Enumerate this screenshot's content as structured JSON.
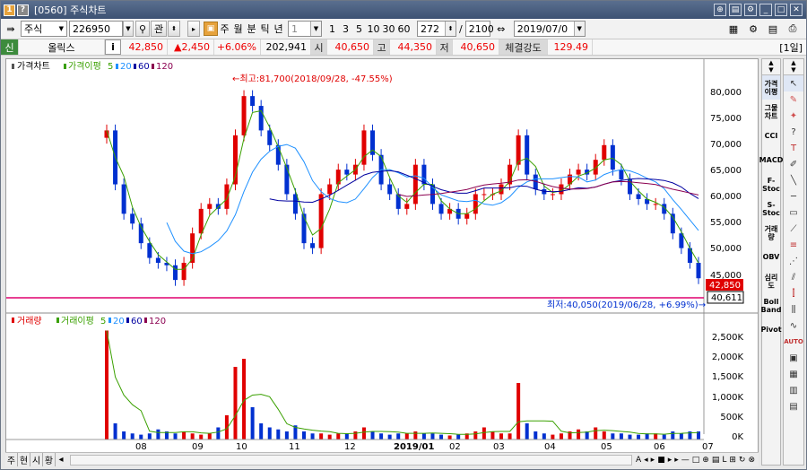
{
  "window": {
    "title": "[0560] 주식차트"
  },
  "toolbar": {
    "market_type": "주식",
    "code": "226950",
    "period_buttons": [
      "주",
      "월",
      "분",
      "틱",
      "년"
    ],
    "interval_value": "1",
    "interval_buttons": [
      "1",
      "3",
      "5",
      "10",
      "30",
      "60"
    ],
    "view_count": "272",
    "total_count": "2100",
    "date": "2019/07/0",
    "sep": "/",
    "search_label": "관"
  },
  "quote": {
    "tag": "신",
    "name": "올릭스",
    "info_btn": "i",
    "price": "42,850",
    "change": "▲2,450",
    "change_pct": "+6.06%",
    "volume": "202,941",
    "open_label": "시",
    "open": "40,650",
    "high_label": "고",
    "high": "44,350",
    "low_label": "저",
    "low": "40,650",
    "strength_label": "체결강도",
    "strength": "129.49",
    "period_tag": "[1일]"
  },
  "price_pane": {
    "legend_title": "가격차트",
    "legend_ma": "가격이평",
    "legend_ma_periods": [
      "5",
      "20",
      "60",
      "120"
    ],
    "y_ticks": [
      "80,000",
      "75,000",
      "70,000",
      "65,000",
      "60,000",
      "55,000",
      "50,000",
      "45,000"
    ],
    "high_annotation": "←최고:81,700(2018/09/28, -47.55%)",
    "low_annotation": "최저:40,050(2019/06/28, +6.99%)→",
    "current_price_label": "42,850",
    "cursor_price_label": "40,611"
  },
  "volume_pane": {
    "legend_title": "거래량",
    "legend_ma": "거래이평",
    "legend_ma_periods": [
      "5",
      "20",
      "60",
      "120"
    ],
    "y_ticks": [
      "2,500K",
      "2,000K",
      "1,500K",
      "1,000K",
      "500K",
      "0K"
    ]
  },
  "x_axis": {
    "labels": [
      "08",
      "09",
      "10",
      "11",
      "12",
      "2019/01",
      "02",
      "03",
      "04",
      "05",
      "06",
      "07"
    ]
  },
  "indicators": [
    "가격이평",
    "그물차트",
    "CCI",
    "MACD",
    "F-Stoc",
    "S-Stoc",
    "거래량",
    "OBV",
    "심리도",
    "Boll Band",
    "Pivot"
  ],
  "bottom_tabs": [
    "주",
    "현",
    "시",
    "황"
  ],
  "colors": {
    "up": "#e00000",
    "down": "#0030d0",
    "ma5": "#3aa000",
    "ma20": "#1e90ff",
    "ma60": "#0000a0",
    "ma120": "#8b0050",
    "low_line": "#e0006e"
  },
  "chart_data": {
    "type": "candlestick",
    "x_range": [
      "2018/07",
      "2019/07"
    ],
    "y_range": [
      40000,
      83000
    ],
    "annotations": {
      "high": 81700,
      "high_date": "2018/09/28",
      "low": 40050,
      "low_date": "2019/06/28"
    },
    "closes": [
      73000,
      62000,
      56000,
      54000,
      50000,
      47000,
      46000,
      45500,
      42500,
      46000,
      52000,
      57000,
      58000,
      57000,
      62000,
      72000,
      80000,
      78000,
      73000,
      70000,
      66000,
      60000,
      56000,
      50000,
      49000,
      60000,
      62000,
      65000,
      64000,
      66000,
      73000,
      68000,
      62000,
      60000,
      57000,
      58000,
      66000,
      62000,
      58000,
      56000,
      57000,
      55000,
      56000,
      60000,
      60000,
      60000,
      62000,
      66000,
      72000,
      64000,
      61000,
      60000,
      60000,
      62000,
      64000,
      65000,
      64000,
      67000,
      70000,
      65000,
      63000,
      60000,
      59000,
      58000,
      58000,
      56000,
      52000,
      49000,
      46000,
      42850
    ],
    "volumes_k": [
      2700,
      400,
      200,
      150,
      120,
      150,
      250,
      200,
      150,
      200,
      150,
      120,
      150,
      300,
      600,
      1800,
      2000,
      800,
      400,
      300,
      250,
      200,
      350,
      200,
      150,
      150,
      120,
      150,
      150,
      200,
      300,
      200,
      150,
      120,
      150,
      150,
      200,
      150,
      150,
      120,
      100,
      120,
      150,
      200,
      300,
      200,
      150,
      150,
      1400,
      400,
      200,
      150,
      120,
      150,
      200,
      250,
      200,
      300,
      200,
      150,
      150,
      120,
      120,
      150,
      150,
      120,
      200,
      150,
      200,
      200
    ]
  }
}
